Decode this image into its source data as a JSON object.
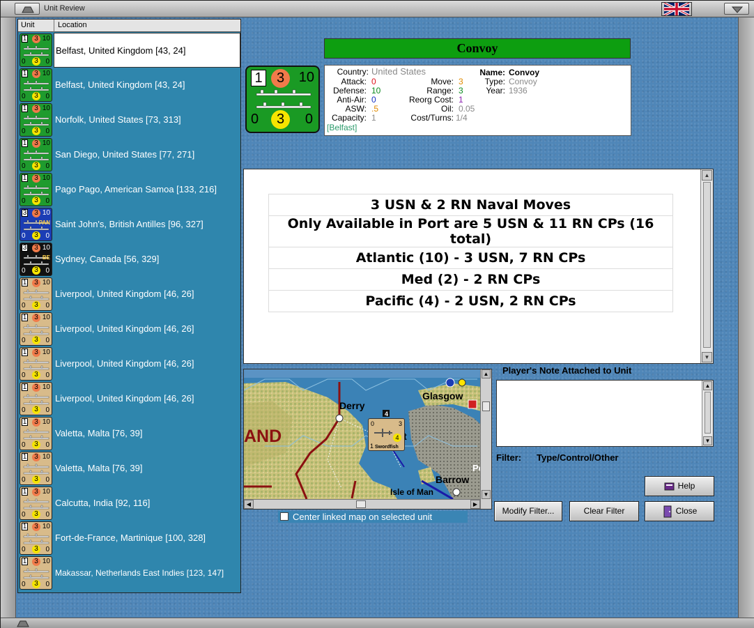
{
  "window": {
    "title": "Unit Review"
  },
  "list": {
    "col_unit": "Unit",
    "col_location": "Location",
    "rows": [
      {
        "location": "Belfast, United Kingdom [43, 24]",
        "color": "green",
        "v": [
          "1",
          "3",
          "10",
          "0",
          "3",
          "0"
        ],
        "tag": ""
      },
      {
        "location": "Belfast, United Kingdom [43, 24]",
        "color": "green",
        "v": [
          "1",
          "3",
          "10",
          "0",
          "3",
          "0"
        ],
        "tag": ""
      },
      {
        "location": "Norfolk, United States [73, 313]",
        "color": "green",
        "v": [
          "1",
          "3",
          "10",
          "0",
          "3",
          "0"
        ],
        "tag": ""
      },
      {
        "location": "San Diego, United States [77, 271]",
        "color": "green",
        "v": [
          "1",
          "3",
          "10",
          "0",
          "3",
          "0"
        ],
        "tag": ""
      },
      {
        "location": "Pago Pago, American Samoa [133, 216]",
        "color": "green",
        "v": [
          "1",
          "3",
          "10",
          "0",
          "3",
          "0"
        ],
        "tag": ""
      },
      {
        "location": "Saint John's, British Antilles [96, 327]",
        "color": "blue",
        "v": [
          "3",
          "3",
          "10",
          "0",
          "3",
          "0"
        ],
        "tag": "PAN"
      },
      {
        "location": "Sydney, Canada [56, 329]",
        "color": "black",
        "v": [
          "3",
          "3",
          "10",
          "0",
          "3",
          "0"
        ],
        "tag": "BE"
      },
      {
        "location": "Liverpool, United Kingdom [46, 26]",
        "color": "tan",
        "v": [
          "1",
          "3",
          "10",
          "0",
          "3",
          "0"
        ],
        "tag": ""
      },
      {
        "location": "Liverpool, United Kingdom [46, 26]",
        "color": "tan",
        "v": [
          "1",
          "3",
          "10",
          "0",
          "3",
          "0"
        ],
        "tag": ""
      },
      {
        "location": "Liverpool, United Kingdom [46, 26]",
        "color": "tan",
        "v": [
          "1",
          "3",
          "10",
          "0",
          "3",
          "0"
        ],
        "tag": ""
      },
      {
        "location": "Liverpool, United Kingdom [46, 26]",
        "color": "tan",
        "v": [
          "1",
          "3",
          "10",
          "0",
          "3",
          "0"
        ],
        "tag": ""
      },
      {
        "location": "Valetta, Malta [76, 39]",
        "color": "tan",
        "v": [
          "1",
          "3",
          "10",
          "0",
          "3",
          "0"
        ],
        "tag": ""
      },
      {
        "location": "Valetta, Malta [76, 39]",
        "color": "tan",
        "v": [
          "1",
          "3",
          "10",
          "0",
          "3",
          "0"
        ],
        "tag": ""
      },
      {
        "location": "Calcutta, India [92, 116]",
        "color": "tan",
        "v": [
          "1",
          "3",
          "10",
          "0",
          "3",
          "0"
        ],
        "tag": ""
      },
      {
        "location": "Fort-de-France, Martinique [100, 328]",
        "color": "tan",
        "v": [
          "1",
          "3",
          "10",
          "0",
          "3",
          "0"
        ],
        "tag": ""
      },
      {
        "location": "Makassar, Netherlands East Indies [123, 147]",
        "color": "tan",
        "v": [
          "1",
          "3",
          "10",
          "0",
          "3",
          "0"
        ],
        "tag": ""
      }
    ]
  },
  "detail": {
    "title": "Convoy",
    "counter": {
      "tl": "1",
      "tm": "3",
      "tr": "10",
      "bl": "0",
      "bm": "3",
      "br": "0"
    },
    "labels": {
      "country": "Country:",
      "attack": "Attack:",
      "defense": "Defense:",
      "anti_air": "Anti-Air:",
      "asw": "ASW:",
      "capacity": "Capacity:",
      "move": "Move:",
      "range": "Range:",
      "reorg": "Reorg Cost:",
      "oil": "Oil:",
      "cost_turns": "Cost/Turns:",
      "name": "Name:",
      "type": "Type:",
      "year": "Year:"
    },
    "values": {
      "country": "United States",
      "attack": "0",
      "defense": "10",
      "anti_air": "0",
      "asw": ".5",
      "capacity": "1",
      "home_port": "[Belfast]",
      "move": "3",
      "range": "3",
      "reorg": "1",
      "oil": "0.05",
      "cost_turns": "1/4",
      "name": "Convoy",
      "type": "Convoy",
      "year": "1936"
    }
  },
  "notes": {
    "lines": [
      "3 USN & 2 RN Naval Moves",
      "Only Available in Port are 5 USN & 11 RN CPs (16 total)",
      "Atlantic (10) - 3 USN, 7 RN CPs",
      "Med (2) - 2 RN CPs",
      "Pacific (4) - 2 USN, 2 RN CPs"
    ]
  },
  "map": {
    "labels": {
      "derry": "Derry",
      "glasgow": "Glasgow",
      "land": "AND",
      "barrow": "Barrow",
      "isle": "Isle of Man",
      "po": "Po",
      "t": "t"
    },
    "unit": {
      "name": "Swordfish",
      "tl": "0",
      "tr": "3",
      "mid": "4",
      "bl": "1"
    },
    "hex_num": "4",
    "center_linked": "Center linked map on selected unit"
  },
  "player_note": {
    "label": "Player's Note Attached to Unit",
    "text": ""
  },
  "filter": {
    "label": "Filter:",
    "value": "Type/Control/Other"
  },
  "buttons": {
    "help": "Help",
    "modify_filter": "Modify Filter...",
    "clear_filter": "Clear Filter",
    "close": "Close"
  },
  "colors": {
    "green_counter": "#1f9b2e",
    "title_bar": "#0d9e10",
    "list_bg": "#2f86ad",
    "sea": "#4f86b8"
  }
}
